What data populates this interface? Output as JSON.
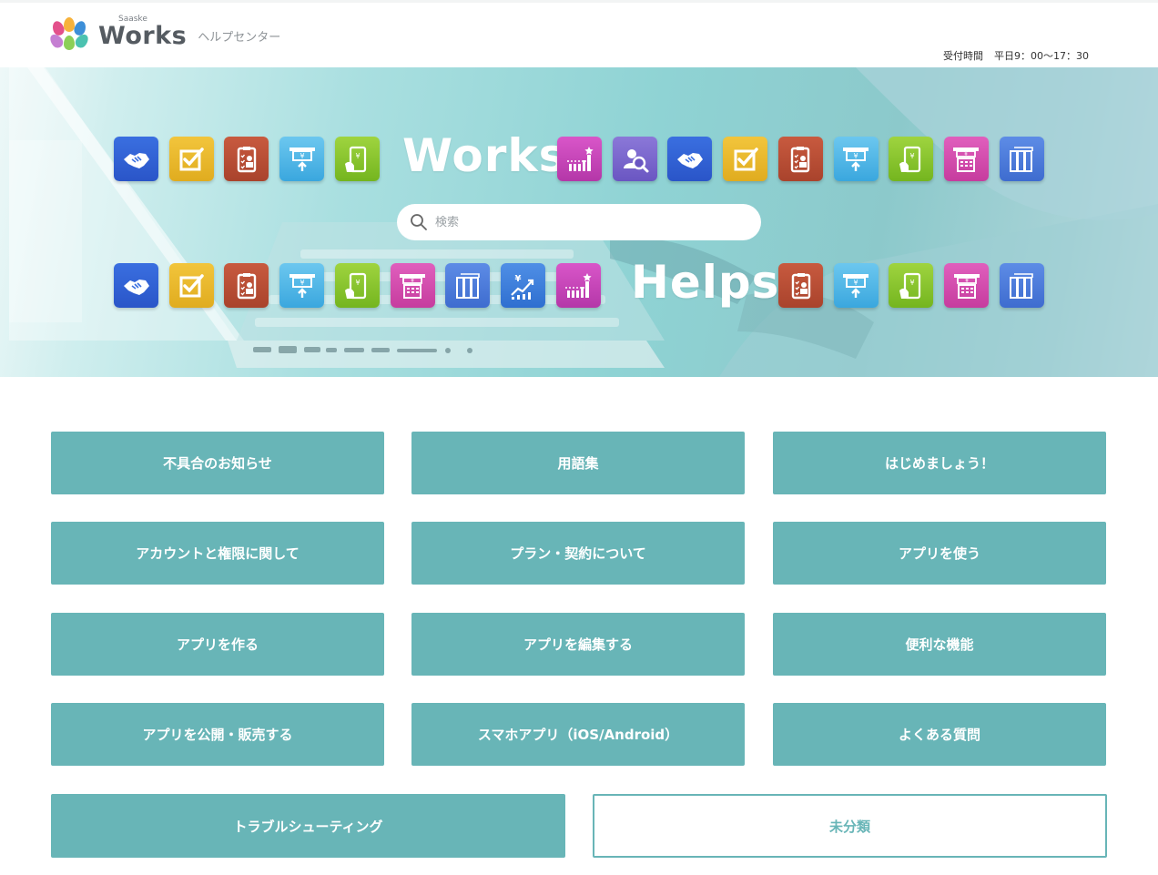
{
  "header": {
    "logo_small": "Saaske",
    "logo_big": "Works",
    "logo_sub": "ヘルプセンター",
    "hours_label": "受付時間",
    "hours_value": "平日9：00〜17：30"
  },
  "hero": {
    "word_top": "Works",
    "word_bottom": "Helps",
    "search_placeholder": "検索",
    "top_icons_left": [
      "handshake-icon",
      "checkbox-icon",
      "clipboard-icon",
      "atm-icon",
      "phone-payment-icon"
    ],
    "top_icons_right": [
      "ranking-chart-icon",
      "user-search-icon",
      "handshake-icon",
      "checkbox-icon",
      "clipboard-icon",
      "atm-icon",
      "phone-payment-icon",
      "yen-calculator-icon",
      "binders-icon"
    ],
    "bottom_icons_left": [
      "handshake-icon",
      "checkbox-icon",
      "clipboard-icon",
      "atm-icon",
      "phone-payment-icon",
      "yen-calculator-icon",
      "binders-icon",
      "yen-growth-icon",
      "ranking-chart-icon"
    ],
    "bottom_icons_right": [
      "clipboard-icon",
      "atm-icon",
      "phone-payment-icon",
      "yen-calculator-icon",
      "binders-icon"
    ]
  },
  "categories": [
    {
      "label": "不具合のお知らせ"
    },
    {
      "label": "用語集"
    },
    {
      "label": "はじめましょう！"
    },
    {
      "label": "アカウントと権限に関して"
    },
    {
      "label": "プラン・契約について"
    },
    {
      "label": "アプリを使う"
    },
    {
      "label": "アプリを作る"
    },
    {
      "label": "アプリを編集する"
    },
    {
      "label": "便利な機能"
    },
    {
      "label": "アプリを公開・販売する"
    },
    {
      "label": "スマホアプリ（iOS/Android）"
    },
    {
      "label": "よくある質問"
    },
    {
      "label": "トラブルシューティング"
    },
    {
      "label": "未分類"
    }
  ],
  "colors": {
    "accent": "#68b5b7",
    "logo_gray": "#555b61"
  }
}
